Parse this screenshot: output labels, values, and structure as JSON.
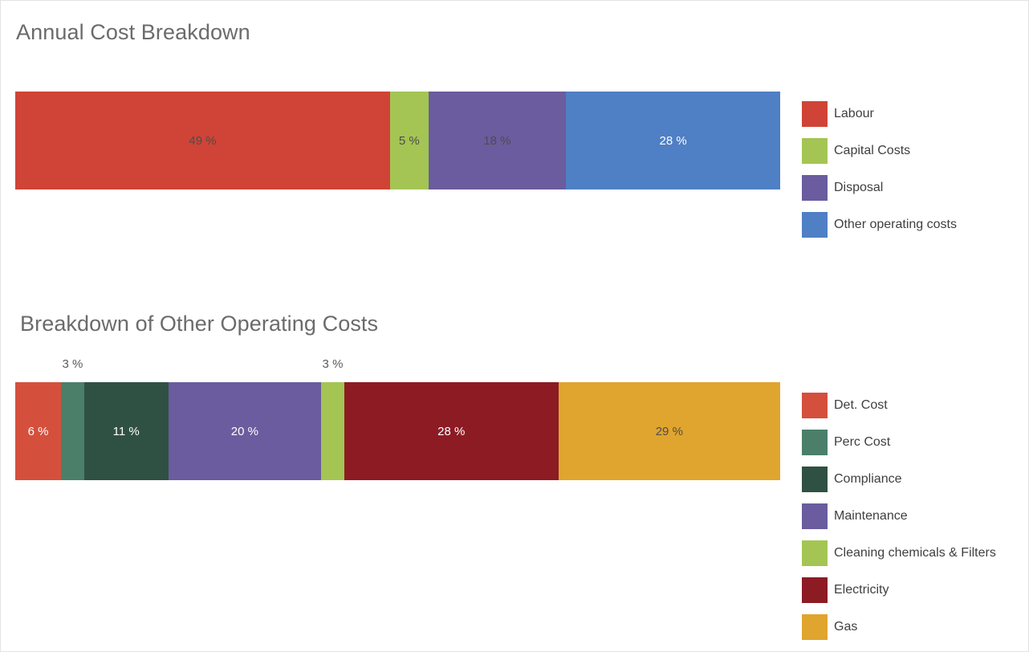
{
  "page": {
    "background": "#ffffff",
    "border_color": "#e3e3e3"
  },
  "charts": [
    {
      "id": "annual-cost-breakdown",
      "title": "Annual Cost Breakdown"
    },
    {
      "id": "other-operating-costs-breakdown",
      "title": "Breakdown of Other Operating Costs"
    }
  ],
  "chart_data": [
    {
      "type": "bar",
      "orientation": "horizontal",
      "stacked": true,
      "title": "Annual Cost Breakdown",
      "xlabel": "",
      "ylabel": "",
      "unit": "%",
      "total": 100,
      "grid": false,
      "legend_position": "right",
      "categories": [
        "Labour",
        "Capital Costs",
        "Disposal",
        "Other operating costs"
      ],
      "values": [
        49,
        5,
        18,
        28
      ],
      "colors": [
        "#cf4436",
        "#a4c553",
        "#6a5c9e",
        "#4f7fc4"
      ],
      "labels": [
        "49 %",
        "5 %",
        "18 %",
        "28 %"
      ],
      "label_colors": [
        "dark",
        "dark",
        "dark",
        "light"
      ],
      "label_placement": [
        "inside",
        "inside",
        "inside",
        "inside"
      ]
    },
    {
      "type": "bar",
      "orientation": "horizontal",
      "stacked": true,
      "title": "Breakdown of Other Operating Costs",
      "xlabel": "",
      "ylabel": "",
      "unit": "%",
      "total": 100,
      "grid": false,
      "legend_position": "right",
      "categories": [
        "Det. Cost",
        "Perc Cost",
        "Compliance",
        "Maintenance",
        "Cleaning chemicals & Filters",
        "Electricity",
        "Gas"
      ],
      "values": [
        6,
        3,
        11,
        20,
        3,
        28,
        29
      ],
      "colors": [
        "#d4503c",
        "#4b7f6a",
        "#2f5143",
        "#6a5c9e",
        "#a4c553",
        "#8c1b24",
        "#e0a52e"
      ],
      "labels": [
        "6 %",
        "3 %",
        "11 %",
        "20 %",
        "3 %",
        "28 %",
        "29 %"
      ],
      "label_colors": [
        "light",
        "dark",
        "light",
        "light",
        "dark",
        "light",
        "dark"
      ],
      "label_placement": [
        "inside",
        "outside-above",
        "inside",
        "inside",
        "outside-above",
        "inside",
        "inside"
      ]
    }
  ],
  "chart1": {
    "title": "Annual Cost Breakdown",
    "segments": [
      {
        "label": "49 %",
        "name": "Labour",
        "value": 49,
        "color": "#cf4436"
      },
      {
        "label": "5 %",
        "name": "Capital Costs",
        "value": 5,
        "color": "#a4c553"
      },
      {
        "label": "18 %",
        "name": "Disposal",
        "value": 18,
        "color": "#6a5c9e"
      },
      {
        "label": "28 %",
        "name": "Other operating costs",
        "value": 28,
        "color": "#4f7fc4"
      }
    ],
    "legend": [
      {
        "label": "Labour",
        "color": "#cf4436"
      },
      {
        "label": "Capital Costs",
        "color": "#a4c553"
      },
      {
        "label": "Disposal",
        "color": "#6a5c9e"
      },
      {
        "label": "Other operating costs",
        "color": "#4f7fc4"
      }
    ]
  },
  "chart2": {
    "title": "Breakdown of Other Operating Costs",
    "segments": [
      {
        "label": "6 %",
        "name": "Det. Cost",
        "value": 6,
        "color": "#d4503c"
      },
      {
        "label": "3 %",
        "name": "Perc Cost",
        "value": 3,
        "color": "#4b7f6a"
      },
      {
        "label": "11 %",
        "name": "Compliance",
        "value": 11,
        "color": "#2f5143"
      },
      {
        "label": "20 %",
        "name": "Maintenance",
        "value": 20,
        "color": "#6a5c9e"
      },
      {
        "label": "3 %",
        "name": "Cleaning chemicals & Filters",
        "value": 3,
        "color": "#a4c553"
      },
      {
        "label": "28 %",
        "name": "Electricity",
        "value": 28,
        "color": "#8c1b24"
      },
      {
        "label": "29 %",
        "name": "Gas",
        "value": 29,
        "color": "#e0a52e"
      }
    ],
    "callouts": [
      {
        "label": "3 %",
        "for": "Perc Cost"
      },
      {
        "label": "3 %",
        "for": "Cleaning chemicals & Filters"
      }
    ],
    "legend": [
      {
        "label": "Det. Cost",
        "color": "#d4503c"
      },
      {
        "label": "Perc Cost",
        "color": "#4b7f6a"
      },
      {
        "label": "Compliance",
        "color": "#2f5143"
      },
      {
        "label": "Maintenance",
        "color": "#6a5c9e"
      },
      {
        "label": "Cleaning chemicals & Filters",
        "color": "#a4c553"
      },
      {
        "label": "Electricity",
        "color": "#8c1b24"
      },
      {
        "label": "Gas",
        "color": "#e0a52e"
      }
    ]
  }
}
